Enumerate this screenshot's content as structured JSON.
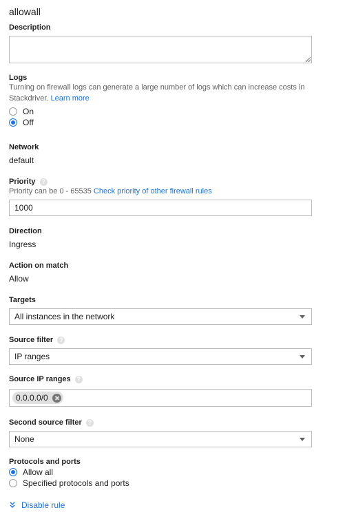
{
  "rule_name": "allowall",
  "description": {
    "label": "Description",
    "value": ""
  },
  "logs": {
    "label": "Logs",
    "help_text": "Turning on firewall logs can generate a large number of logs which can increase costs in",
    "help_text_2": "Stackdriver.",
    "learn_more": "Learn more",
    "options": [
      {
        "label": "On",
        "selected": false
      },
      {
        "label": "Off",
        "selected": true
      }
    ]
  },
  "network": {
    "label": "Network",
    "value": "default"
  },
  "priority": {
    "label": "Priority",
    "help_text": "Priority can be 0 - 65535",
    "link": "Check priority of other firewall rules",
    "value": "1000"
  },
  "direction": {
    "label": "Direction",
    "value": "Ingress"
  },
  "action_on_match": {
    "label": "Action on match",
    "value": "Allow"
  },
  "targets": {
    "label": "Targets",
    "value": "All instances in the network"
  },
  "source_filter": {
    "label": "Source filter",
    "value": "IP ranges"
  },
  "source_ip_ranges": {
    "label": "Source IP ranges",
    "chips": [
      "0.0.0.0/0"
    ]
  },
  "second_source_filter": {
    "label": "Second source filter",
    "value": "None"
  },
  "protocols": {
    "label": "Protocols and ports",
    "options": [
      {
        "label": "Allow all",
        "selected": true
      },
      {
        "label": "Specified protocols and ports",
        "selected": false
      }
    ]
  },
  "disable_rule": "Disable rule",
  "colors": {
    "accent": "#1a73e8",
    "border": "#bdbdbd",
    "text": "#212121",
    "help": "#616161"
  }
}
